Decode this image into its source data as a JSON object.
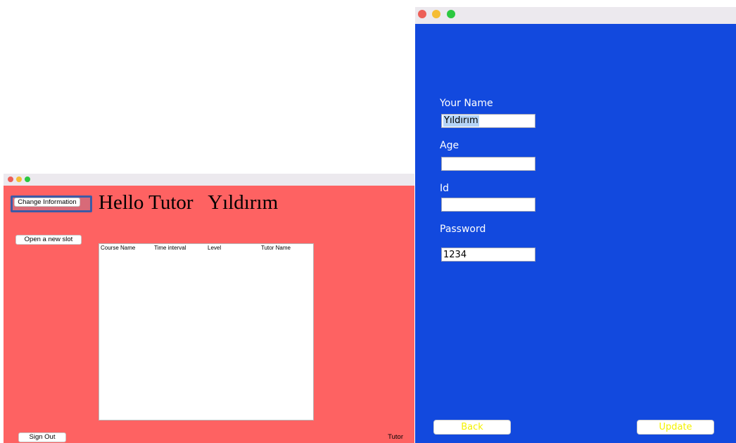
{
  "tutor_window": {
    "change_info_label": "Change Information",
    "greeting": "Hello Tutor   Yıldırım",
    "open_slot_label": "Open a new slot",
    "table": {
      "columns": [
        "Course Name",
        "Time interval",
        "Level",
        "Tutor Name"
      ]
    },
    "sign_out_label": "Sign Out",
    "role_label": "Tutor",
    "colors": {
      "background": "#fe6262"
    }
  },
  "info_window": {
    "fields": {
      "name_label": "Your Name",
      "name_value": "Yıldırım",
      "age_label": "Age",
      "age_value": "",
      "id_label": "Id",
      "id_value": "",
      "password_label": "Password",
      "password_value": "1234"
    },
    "back_label": "Back",
    "update_label": "Update",
    "colors": {
      "background": "#1249de",
      "button_text": "#f4f200"
    }
  }
}
